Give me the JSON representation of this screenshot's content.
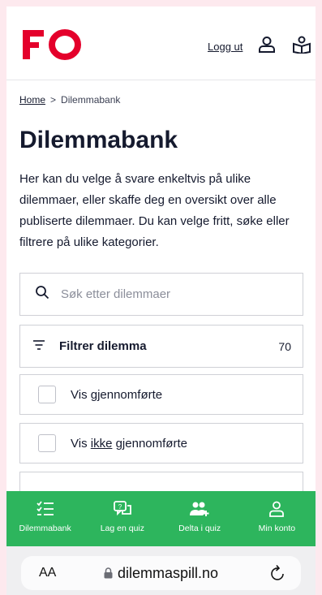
{
  "header": {
    "logo_text": "FO",
    "logout_label": "Logg ut",
    "icons": [
      "user-icon",
      "gift-book-icon"
    ]
  },
  "breadcrumb": {
    "home": "Home",
    "separator": ">",
    "current": "Dilemmabank"
  },
  "page": {
    "title": "Dilemmabank",
    "intro": "Her kan du velge å svare enkeltvis på ulike dilemmaer, eller skaffe deg en oversikt over alle publiserte dilemmaer. Du kan velge fritt, søke eller filtrere på ulike kategorier."
  },
  "search": {
    "placeholder": "Søk etter dilemmaer"
  },
  "filter": {
    "label": "Filtrer dilemma",
    "count": "70"
  },
  "checkboxes": {
    "done": "Vis gjennomførte",
    "not_prefix": "Vis ",
    "not_word": "ikke",
    "not_suffix": " gjennomførte"
  },
  "nav": {
    "items": [
      {
        "label": "Dilemmabank",
        "icon": "checklist-icon"
      },
      {
        "label": "Lag en quiz",
        "icon": "quiz-chat-icon"
      },
      {
        "label": "Delta i quiz",
        "icon": "users-add-icon"
      },
      {
        "label": "Min konto",
        "icon": "user-icon"
      }
    ]
  },
  "browser": {
    "text_size": "AA",
    "url": "dilemmaspill.no"
  },
  "colors": {
    "brand_red": "#e4002b",
    "nav_green": "#2db55d",
    "text": "#151a2e"
  }
}
